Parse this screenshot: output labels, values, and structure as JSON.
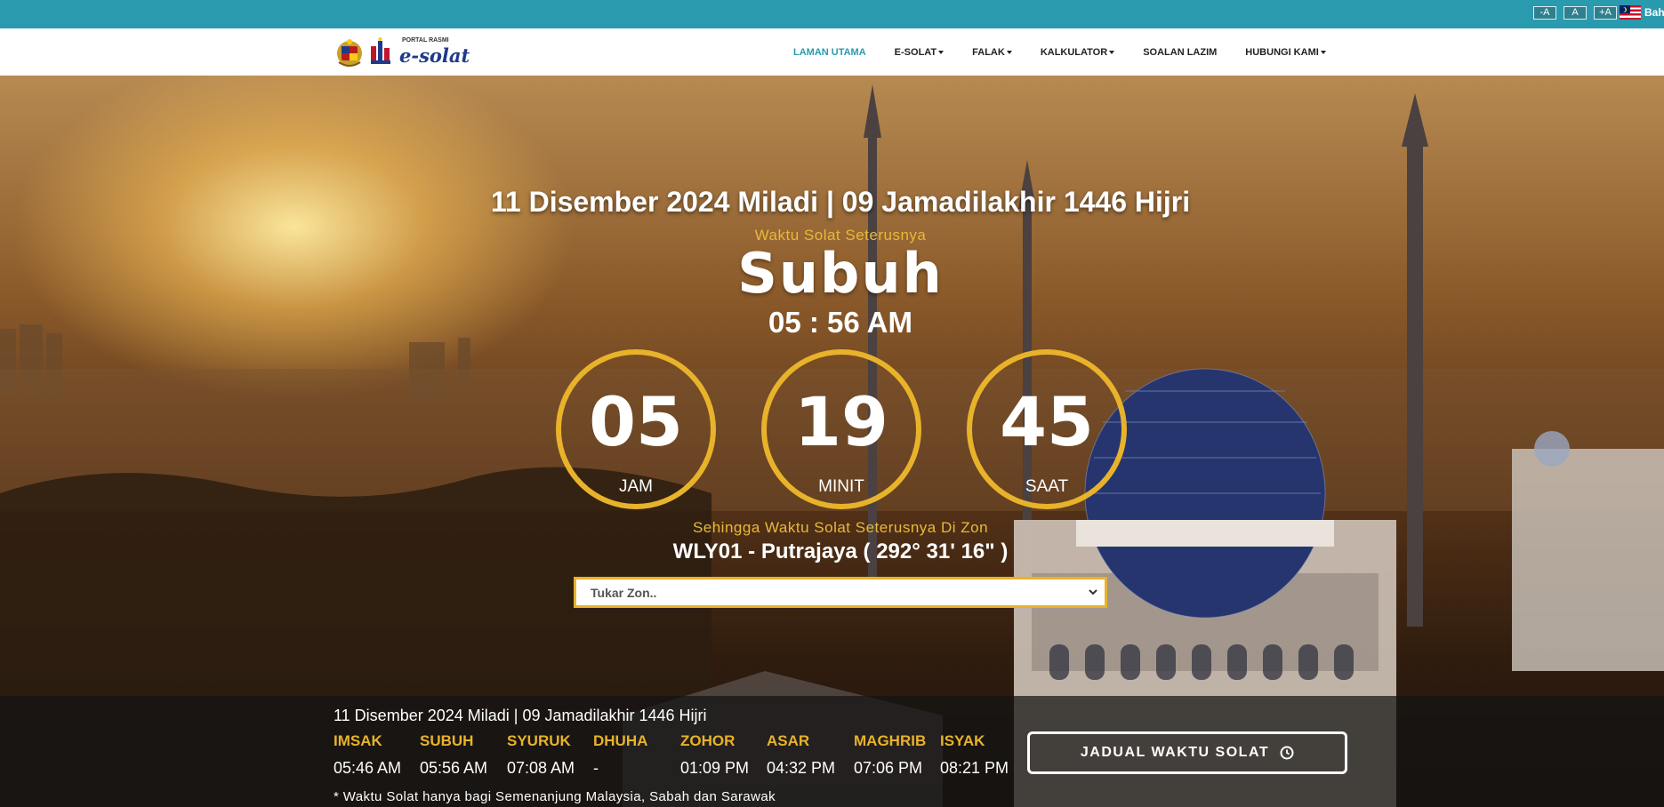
{
  "topbar": {
    "font_buttons": [
      "-A",
      "A",
      "+A"
    ],
    "language": "Bah"
  },
  "brand": {
    "logo_small": "PORTAL RASMI",
    "logo_name": "e-solat"
  },
  "nav": {
    "items": [
      {
        "label": "LAMAN UTAMA",
        "dropdown": false,
        "active": true
      },
      {
        "label": "E-SOLAT",
        "dropdown": true,
        "active": false
      },
      {
        "label": "FALAK",
        "dropdown": true,
        "active": false
      },
      {
        "label": "KALKULATOR",
        "dropdown": true,
        "active": false
      },
      {
        "label": "SOALAN LAZIM",
        "dropdown": false,
        "active": false
      },
      {
        "label": "HUBUNGI KAMI",
        "dropdown": true,
        "active": false
      }
    ]
  },
  "hero": {
    "date_line": "11 Disember 2024 Miladi | 09 Jamadilakhir 1446 Hijri",
    "next_label": "Waktu Solat Seterusnya",
    "prayer_name": "Subuh",
    "prayer_time": "05 : 56 AM",
    "countdown": [
      {
        "value": "05",
        "unit": "JAM"
      },
      {
        "value": "19",
        "unit": "MINIT"
      },
      {
        "value": "45",
        "unit": "SAAT"
      }
    ],
    "until_label": "Sehingga Waktu Solat Seterusnya Di Zon",
    "zone": "WLY01 - Putrajaya ( 292° 31' 16\" )",
    "zone_select_placeholder": "Tukar Zon.."
  },
  "bottom": {
    "date_line": "11 Disember 2024 Miladi | 09 Jamadilakhir 1446 Hijri",
    "prayers": [
      {
        "name": "IMSAK",
        "time": "05:46 AM"
      },
      {
        "name": "SUBUH",
        "time": "05:56 AM"
      },
      {
        "name": "SYURUK",
        "time": "07:08 AM"
      },
      {
        "name": "DHUHA",
        "time": "-"
      },
      {
        "name": "ZOHOR",
        "time": "01:09 PM"
      },
      {
        "name": "ASAR",
        "time": "04:32 PM"
      },
      {
        "name": "MAGHRIB",
        "time": "07:06 PM"
      },
      {
        "name": "ISYAK",
        "time": "08:21 PM"
      }
    ],
    "note": "* Waktu Solat hanya bagi Semenanjung Malaysia, Sabah dan Sarawak",
    "schedule_button": "JADUAL WAKTU SOLAT"
  },
  "colors": {
    "topbar": "#2a9aae",
    "accent_gold": "#e8b32a",
    "active_nav": "#2a9aae"
  },
  "icons": [
    "malaysia-flag-icon",
    "caret-down-icon",
    "chevron-down-icon",
    "clock-icon",
    "coat-of-arms-icon"
  ]
}
